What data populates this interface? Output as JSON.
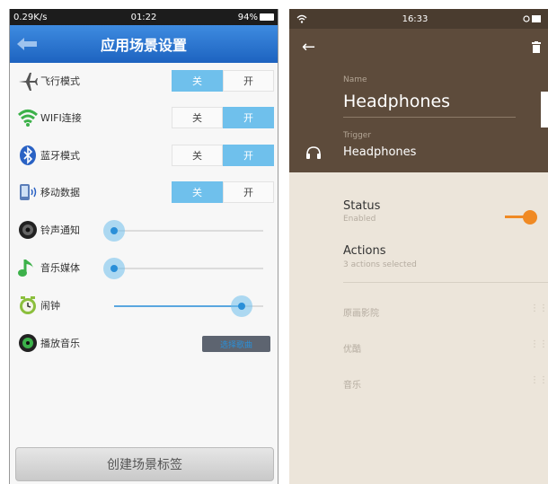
{
  "left_phone": {
    "status_bar": {
      "left": "0.29K/s",
      "time": "01:22",
      "right": "94%"
    },
    "header": {
      "title": "应用场景设置"
    },
    "rows": [
      {
        "label": "飞行模式",
        "type": "toggle",
        "off_label": "关",
        "on_label": "开",
        "state": "off"
      },
      {
        "label": "WIFI连接",
        "type": "toggle",
        "off_label": "关",
        "on_label": "开",
        "state": "on"
      },
      {
        "label": "蓝牙模式",
        "type": "toggle",
        "off_label": "关",
        "on_label": "开",
        "state": "on"
      },
      {
        "label": "移动数据",
        "type": "toggle",
        "off_label": "关",
        "on_label": "开",
        "state": "off"
      },
      {
        "label": "铃声通知",
        "type": "slider",
        "level": 0.0
      },
      {
        "label": "音乐媒体",
        "type": "slider",
        "level": 0.0
      },
      {
        "label": "闹钟",
        "type": "slider",
        "level": 0.9
      },
      {
        "label": "播放音乐",
        "type": "button",
        "button_label": "选择歌曲"
      }
    ],
    "create_button": "创建场景标签",
    "colors": {
      "accent": "#6fc0ec",
      "header": "#2a72cc"
    }
  },
  "right_phone": {
    "status_bar": {
      "time": "16:33"
    },
    "name_label": "Name",
    "name_value": "Headphones",
    "trigger_label": "Trigger",
    "trigger_value": "Headphones",
    "status": {
      "title": "Status",
      "subtitle": "Enabled",
      "enabled": true
    },
    "actions": {
      "title": "Actions",
      "subtitle": "3 actions selected"
    },
    "apps": [
      "原画影院",
      "优酷",
      "音乐"
    ],
    "colors": {
      "header": "#5d4b3b",
      "accent": "#f08a24",
      "background": "#ece5da"
    }
  }
}
